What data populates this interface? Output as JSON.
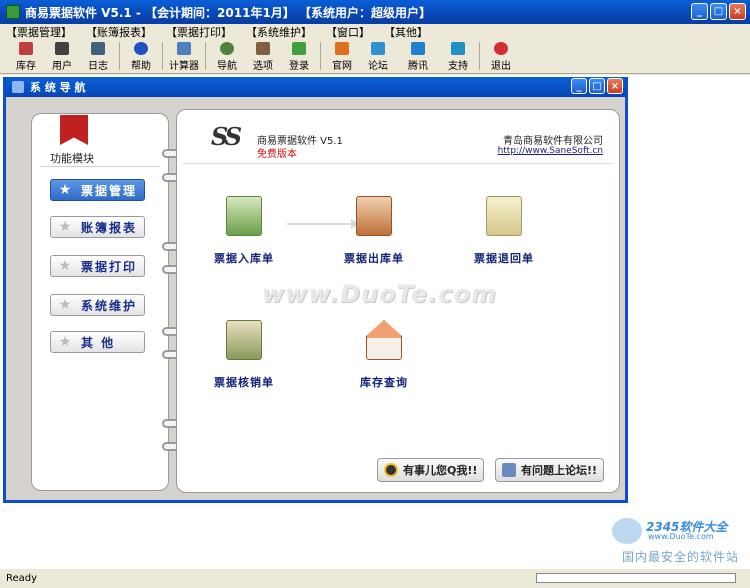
{
  "app": {
    "title": "商易票据软件 V5.1 - 【会计期间：2011年1月】 【系统用户：超级用户】"
  },
  "window_buttons": {
    "minimize": "_",
    "maximize": "□",
    "close": "×"
  },
  "menu": [
    "【票据管理】",
    "【账簿报表】",
    "【票据打印】",
    "【系统维护】",
    "【窗口】",
    "【其他】"
  ],
  "toolbar": [
    {
      "label": "库存",
      "icon": "home-icon",
      "color": "#c04040"
    },
    {
      "label": "用户",
      "icon": "user-icon",
      "color": "#404040"
    },
    {
      "label": "日志",
      "icon": "log-icon",
      "color": "#406080"
    },
    {
      "label": "帮助",
      "icon": "help-icon",
      "color": "#2050c0"
    },
    {
      "label": "计算器",
      "icon": "calculator-icon",
      "color": "#5080c0"
    },
    {
      "label": "导航",
      "icon": "navigate-icon",
      "color": "#508040"
    },
    {
      "label": "选项",
      "icon": "options-icon",
      "color": "#806040"
    },
    {
      "label": "登录",
      "icon": "login-icon",
      "color": "#40a040"
    },
    {
      "label": "官网",
      "icon": "website-icon",
      "color": "#e07020"
    },
    {
      "label": "论坛",
      "icon": "forum-icon",
      "color": "#3090d0"
    },
    {
      "label": "腾讯",
      "icon": "qq-icon",
      "color": "#2080d0"
    },
    {
      "label": "支持",
      "icon": "support-icon",
      "color": "#2090c0"
    },
    {
      "label": "退出",
      "icon": "exit-icon",
      "color": "#d03030"
    }
  ],
  "nav_window": {
    "title": "系 统 导 航"
  },
  "left": {
    "section_label": "功能模块",
    "buttons": [
      {
        "label": "票据管理",
        "active": true
      },
      {
        "label": "账簿报表",
        "active": false
      },
      {
        "label": "票据打印",
        "active": false
      },
      {
        "label": "系统维护",
        "active": false
      },
      {
        "label": "其 他",
        "active": false
      }
    ]
  },
  "right": {
    "logo_text": "SS",
    "product": "商易票据软件 V5.1",
    "edition": "免费版本",
    "company": "青岛商易软件有限公司",
    "url": "http://www.SaneSoft.cn",
    "items": [
      {
        "label": "票据入库单",
        "icon": "stock-in-icon",
        "color": "#6aa04a"
      },
      {
        "label": "票据出库单",
        "icon": "stock-out-icon",
        "color": "#c0703a"
      },
      {
        "label": "票据退回单",
        "icon": "return-icon",
        "color": "#d8c88a"
      },
      {
        "label": "票据核销单",
        "icon": "writeoff-icon",
        "color": "#8a9a5a"
      },
      {
        "label": "库存查询",
        "icon": "inventory-house-icon",
        "color": "#d06030"
      }
    ],
    "watermark": "www.DuoTe.com",
    "footer_buttons": [
      "有事儿您Q我!!",
      "有问题上论坛!!"
    ]
  },
  "status": {
    "text": "Ready"
  },
  "brand_watermark": {
    "line1": "2345软件大全",
    "line2": "www.DuoTe.com",
    "line3": "国内最安全的软件站"
  }
}
